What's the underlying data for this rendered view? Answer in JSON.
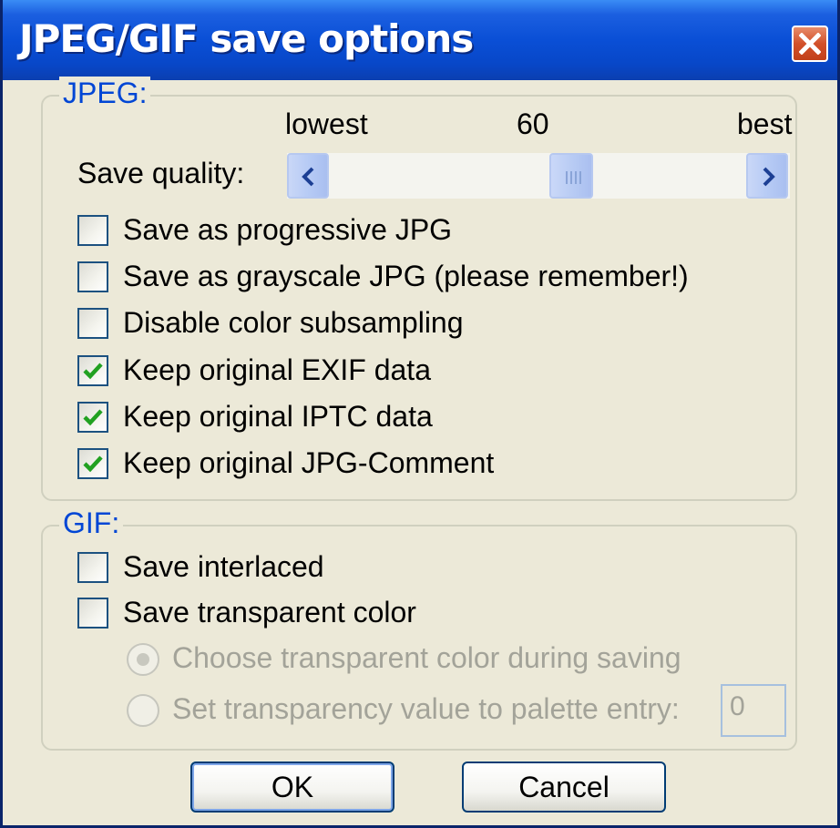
{
  "window": {
    "title": "JPEG/GIF save options",
    "close_icon": "close-x-icon"
  },
  "jpeg": {
    "group_label": "JPEG:",
    "quality": {
      "low_label": "lowest",
      "value_label": "60",
      "high_label": "best",
      "label": "Save quality:",
      "value": 60,
      "min": 0,
      "max": 100
    },
    "options": [
      {
        "label": "Save as progressive JPG",
        "checked": false
      },
      {
        "label": "Save as grayscale JPG (please remember!)",
        "checked": false
      },
      {
        "label": "Disable color subsampling",
        "checked": false
      },
      {
        "label": "Keep original EXIF data",
        "checked": true
      },
      {
        "label": "Keep original IPTC data",
        "checked": true
      },
      {
        "label": "Keep original JPG-Comment",
        "checked": true
      }
    ]
  },
  "gif": {
    "group_label": "GIF:",
    "options": [
      {
        "label": "Save interlaced",
        "checked": false
      },
      {
        "label": "Save transparent color",
        "checked": false
      }
    ],
    "radios": [
      {
        "label": "Choose transparent color during saving",
        "selected": true,
        "disabled": true
      },
      {
        "label": "Set transparency value to palette entry:",
        "selected": false,
        "disabled": true
      }
    ],
    "palette_entry_value": "0"
  },
  "buttons": {
    "ok": "OK",
    "cancel": "Cancel"
  },
  "colors": {
    "titlebar": "#0a4fd6",
    "group_label": "#0046d5",
    "check_mark": "#21a121",
    "disabled_text": "#a3a399"
  }
}
